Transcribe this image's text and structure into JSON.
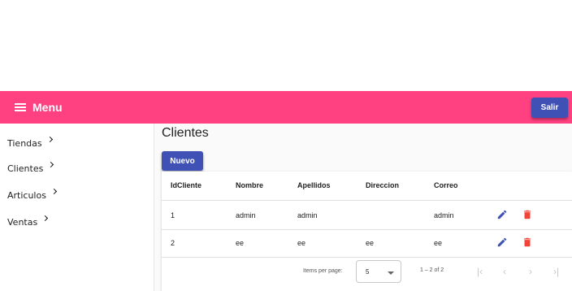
{
  "toolbar": {
    "menu_label": "Menu",
    "logout_label": "Salir"
  },
  "sidebar": {
    "items": [
      {
        "label": "Tiendas"
      },
      {
        "label": "Clientes"
      },
      {
        "label": "Articulos"
      },
      {
        "label": "Ventas"
      }
    ]
  },
  "page": {
    "title": "Clientes",
    "new_button": "Nuevo"
  },
  "table": {
    "columns": [
      "IdCliente",
      "Nombre",
      "Apellidos",
      "Direccion",
      "Correo"
    ],
    "rows": [
      {
        "id": "1",
        "nombre": "admin",
        "apellidos": "admin",
        "direccion": "",
        "correo": "admin"
      },
      {
        "id": "2",
        "nombre": "ee",
        "apellidos": "ee",
        "direccion": "ee",
        "correo": "ee"
      }
    ]
  },
  "paginator": {
    "items_per_page_label": "Items per page:",
    "page_size": "5",
    "range_label": "1 – 2 of 2"
  },
  "colors": {
    "toolbar": "#ff4081",
    "primary": "#3f51b5",
    "delete": "#f44336"
  },
  "icons": {
    "menu": "hamburger-icon",
    "edit": "pencil-icon",
    "delete": "trash-icon"
  }
}
